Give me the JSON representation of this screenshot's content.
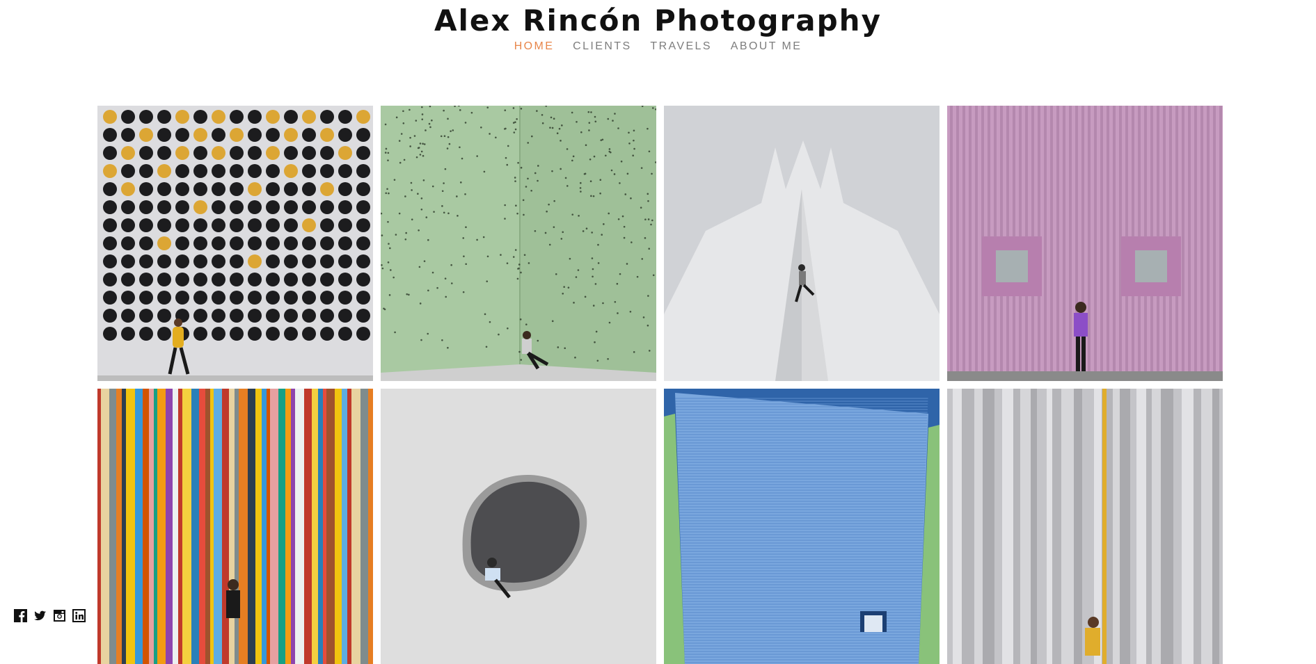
{
  "site": {
    "title": "Alex Rincón Photography"
  },
  "nav": {
    "items": [
      {
        "label": "HOME",
        "active": true
      },
      {
        "label": "CLIENTS",
        "active": false
      },
      {
        "label": "TRAVELS",
        "active": false
      },
      {
        "label": "ABOUT ME",
        "active": false
      }
    ]
  },
  "colors": {
    "accent": "#e8864a",
    "nav_text": "#7d7d7d",
    "title_text": "#111111"
  },
  "gallery": {
    "photos": [
      {
        "subject": "dot-wall",
        "palette": [
          "#d9d9dc",
          "#1b1b1d",
          "#dba634",
          "#e3b321"
        ]
      },
      {
        "subject": "perforated-green-building",
        "palette": [
          "#a8c7a1",
          "#8fb58a",
          "#2b2b2b"
        ]
      },
      {
        "subject": "white-spiked-roof",
        "palette": [
          "#cfd1d5",
          "#b7b9bd",
          "#1a1a1a"
        ]
      },
      {
        "subject": "pink-ribbed-facade",
        "palette": [
          "#c599bd",
          "#b286ad",
          "#8a4fc0"
        ]
      },
      {
        "subject": "striped-colored-columns",
        "palette": [
          "#c0392b",
          "#f1c40f",
          "#3498db",
          "#e67e22"
        ]
      },
      {
        "subject": "wall-opening",
        "palette": [
          "#dcdcdc",
          "#8a8a8a",
          "#4a4a4a"
        ]
      },
      {
        "subject": "blue-ridged-wall",
        "palette": [
          "#6b9fdc",
          "#8fbf74",
          "#2a5aa8"
        ]
      },
      {
        "subject": "grey-striped-wall",
        "palette": [
          "#cfcfd2",
          "#b3b3b7",
          "#e0ad2c"
        ]
      }
    ]
  },
  "social": [
    {
      "name": "facebook-icon"
    },
    {
      "name": "twitter-icon"
    },
    {
      "name": "instagram-icon"
    },
    {
      "name": "linkedin-icon"
    }
  ]
}
